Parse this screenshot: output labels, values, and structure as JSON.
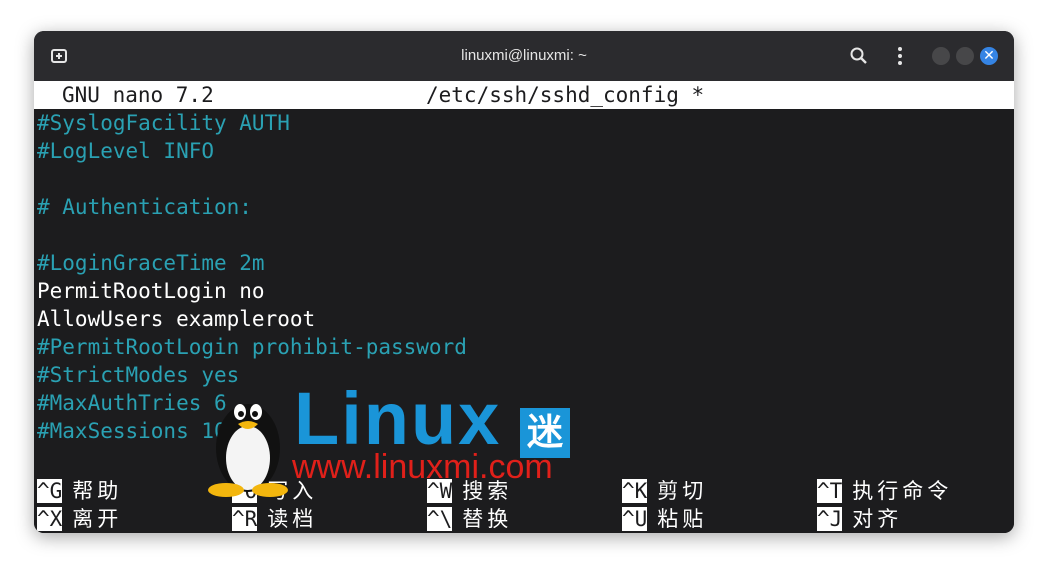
{
  "window": {
    "title": "linuxmi@linuxmi: ~",
    "icons": [
      "new-tab-icon",
      "search-icon",
      "menu-icon",
      "minimize-icon",
      "maximize-icon",
      "close-icon"
    ],
    "accent_color": "#3584e4"
  },
  "nano": {
    "version": "GNU nano 7.2",
    "filename": "/etc/ssh/sshd_config *",
    "lines": [
      {
        "text": "#SyslogFacility AUTH",
        "kind": "comment"
      },
      {
        "text": "#LogLevel INFO",
        "kind": "comment"
      },
      {
        "text": "",
        "kind": "blank"
      },
      {
        "text": "# Authentication:",
        "kind": "comment"
      },
      {
        "text": "",
        "kind": "blank"
      },
      {
        "text": "#LoginGraceTime 2m",
        "kind": "comment"
      },
      {
        "text": "PermitRootLogin no",
        "kind": "code"
      },
      {
        "text": "AllowUsers exampleroot",
        "kind": "code"
      },
      {
        "text": "#PermitRootLogin prohibit-password",
        "kind": "comment"
      },
      {
        "text": "#StrictModes yes",
        "kind": "comment"
      },
      {
        "text": "#MaxAuthTries 6",
        "kind": "comment"
      },
      {
        "text": "#MaxSessions 10",
        "kind": "comment"
      }
    ],
    "comment_color": "#2aa1b3",
    "shortcuts": [
      {
        "key": "^G",
        "label": "帮助"
      },
      {
        "key": "^O",
        "label": "写入"
      },
      {
        "key": "^W",
        "label": "搜索"
      },
      {
        "key": "^K",
        "label": "剪切"
      },
      {
        "key": "^T",
        "label": "执行命令"
      },
      {
        "key": "^X",
        "label": "离开"
      },
      {
        "key": "^R",
        "label": "读档"
      },
      {
        "key": "^\\",
        "label": "替换"
      },
      {
        "key": "^U",
        "label": "粘贴"
      },
      {
        "key": "^J",
        "label": "对齐"
      }
    ]
  },
  "watermark": {
    "brand": "Linux",
    "brand_suffix": "迷",
    "url": "www.linuxmi.com",
    "brand_color": "#1a95d8",
    "url_color": "#e0201a"
  }
}
